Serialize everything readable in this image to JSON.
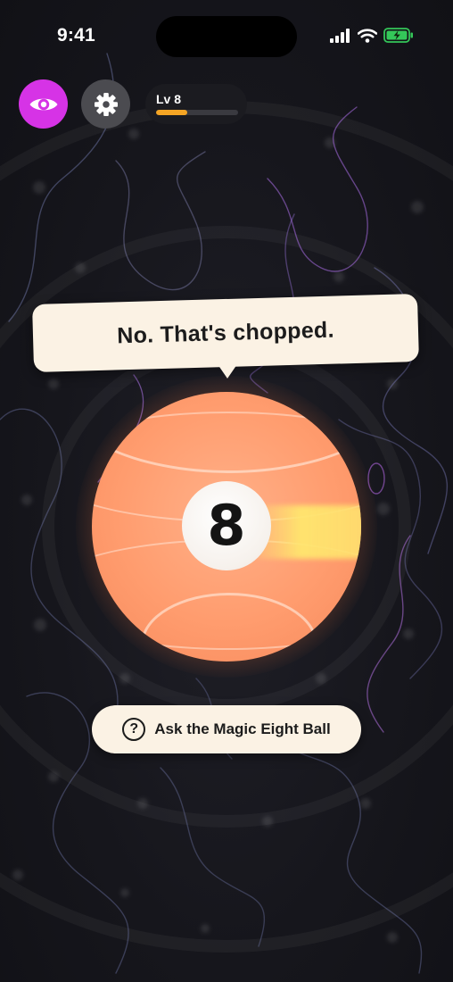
{
  "status_bar": {
    "time": "9:41",
    "icons": [
      "signal-icon",
      "wifi-icon",
      "battery-charging-icon"
    ]
  },
  "top_bar": {
    "eye_button_icon": "eye-icon",
    "settings_button_icon": "gear-icon",
    "level_label": "Lv 8",
    "level_progress": 0.38
  },
  "answer": {
    "text": "No. That's chopped."
  },
  "ball": {
    "number": "8"
  },
  "ask_button": {
    "icon": "question-icon",
    "icon_glyph": "?",
    "label": "Ask the Magic Eight Ball"
  },
  "colors": {
    "background": "#15151b",
    "eye_button": "#d633e6",
    "settings_button": "#4b4b50",
    "level_fill": "#f5a524",
    "ball": "#ff9c6e",
    "bubble": "#fbf2e4",
    "battery": "#34c759"
  }
}
